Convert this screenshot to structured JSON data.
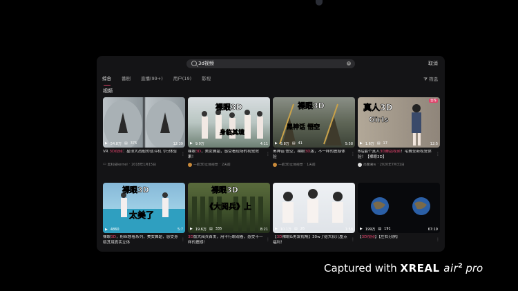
{
  "search": {
    "value": "3d视频",
    "cancel_label": "取消"
  },
  "tabs": [
    "综合",
    "番剧",
    "直播(99+)",
    "用户(19)",
    "影视"
  ],
  "filter_label": "筛选",
  "section_title": "视频",
  "videos": [
    {
      "title_pre": "VR ",
      "title_hl": "3D视频",
      "title_post": "：星球大战般的战斗机飞行体验",
      "views": "54.8万",
      "danmaku": "375",
      "duration": "12:39",
      "author": "黑科技kernel",
      "date": "2018年1月15日",
      "thumb_text": "",
      "thumb_sub": ""
    },
    {
      "title_pre": "裸眼",
      "title_hl": "3D",
      "title_post": "，美女舞蹈，感受看现场的视觉效果！",
      "views": "9.9万",
      "danmaku": "",
      "duration": "4:11",
      "author": "一航3D立体视觉",
      "date": "2天前",
      "thumb_text": "裸眼3D",
      "thumb_sub": "身临其境"
    },
    {
      "title_pre": "黑神话 悟空，裸眼",
      "title_hl": "3D",
      "title_post": "版，不一样的震撼体验",
      "views": "5.8万",
      "danmaku": "41",
      "duration": "5:58",
      "author": "一航3D立体视觉",
      "date": "1天前",
      "thumb_text": "裸眼3D",
      "thumb_sub": "黑神话 悟空"
    },
    {
      "title_pre": "B站最个真人",
      "title_hl": "3D舞蹈视频",
      "title_post": "！宅舞全新视觉体验！【裸眼3D】",
      "views": "1.6万",
      "danmaku": "17",
      "duration": "12:5",
      "author": "尚馨君w",
      "date": "2020年7月31日",
      "thumb_text": "真人3D",
      "thumb_sub": "Girls",
      "badge": "合作"
    },
    {
      "title_pre": "裸眼",
      "title_hl": "3D",
      "title_post": "，粉丝想看系列，美女舞蹈，感受身临其境真实立体",
      "views": "4860",
      "danmaku": "",
      "duration": "5:7",
      "author": "",
      "date": "",
      "thumb_text": "裸眼3D",
      "thumb_sub": "太美了"
    },
    {
      "title_pre": "",
      "title_hl": "3D",
      "title_post": "版大阅兵首发，用平行眼观看，感受不一样的震撼！",
      "views": "19.6万",
      "danmaku": "335",
      "duration": "8:21",
      "author": "",
      "date": "",
      "thumb_text": "裸眼3D",
      "thumb_sub": "《大阅兵》上"
    },
    {
      "title_pre": "【",
      "title_hl": "3D",
      "title_post": "裸眼&男友视角】30w了给大伙儿整点福利！",
      "views": "10.1万",
      "danmaku": "26",
      "duration": "1:58",
      "author": "",
      "date": "",
      "thumb_text": "",
      "thumb_sub": ""
    },
    {
      "title_pre": "【",
      "title_hl": "3D视频",
      "title_post": "】【左右分屏】",
      "views": "199万",
      "danmaku": "191",
      "duration": "67:19",
      "author": "",
      "date": "",
      "thumb_text": "",
      "thumb_sub": ""
    }
  ],
  "watermark": {
    "pre": "Captured with ",
    "brand": "XREAL ",
    "model": "air",
    "sup": "2",
    "suffix": " pro"
  },
  "colors": {
    "accent": "#e0436b",
    "panel": "#141416"
  }
}
